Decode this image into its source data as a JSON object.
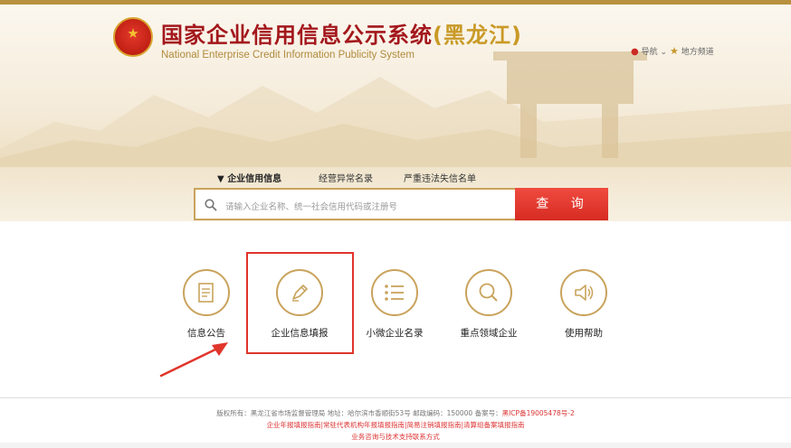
{
  "header": {
    "title_cn": "国家企业信用信息公示系统",
    "title_region": "(黑龙江)",
    "title_en": "National Enterprise Credit Information Publicity System",
    "nav_label": "导航",
    "local_channel_label": "地方频道"
  },
  "search": {
    "tabs": [
      "企业信用信息",
      "经营异常名录",
      "严重违法失信名单"
    ],
    "active_tab": 0,
    "placeholder": "请输入企业名称、统一社会信用代码或注册号",
    "button_label": "查 询"
  },
  "shortcuts": [
    {
      "label": "信息公告",
      "icon": "document-icon"
    },
    {
      "label": "企业信息填报",
      "icon": "pen-icon"
    },
    {
      "label": "小微企业名录",
      "icon": "list-icon"
    },
    {
      "label": "重点领域企业",
      "icon": "magnifier-icon"
    },
    {
      "label": "使用帮助",
      "icon": "speaker-icon"
    }
  ],
  "footer": {
    "line1_prefix": "版权所有：黑龙江省市场监督管理局 地址：哈尔滨市香顺街53号 邮政编码：150000 备案号：",
    "icp": "黑ICP备19005478号-2",
    "line2": "企业年报填报指南|常驻代表机构年报填报指南|简易注销填报指南|清算组备案填报指南",
    "line3": "业务咨询与技术支持联系方式"
  },
  "colors": {
    "brand_red": "#a3171c",
    "accent_gold": "#c9a35c",
    "search_button": "#e0352b",
    "highlight_box": "#e0352b"
  }
}
